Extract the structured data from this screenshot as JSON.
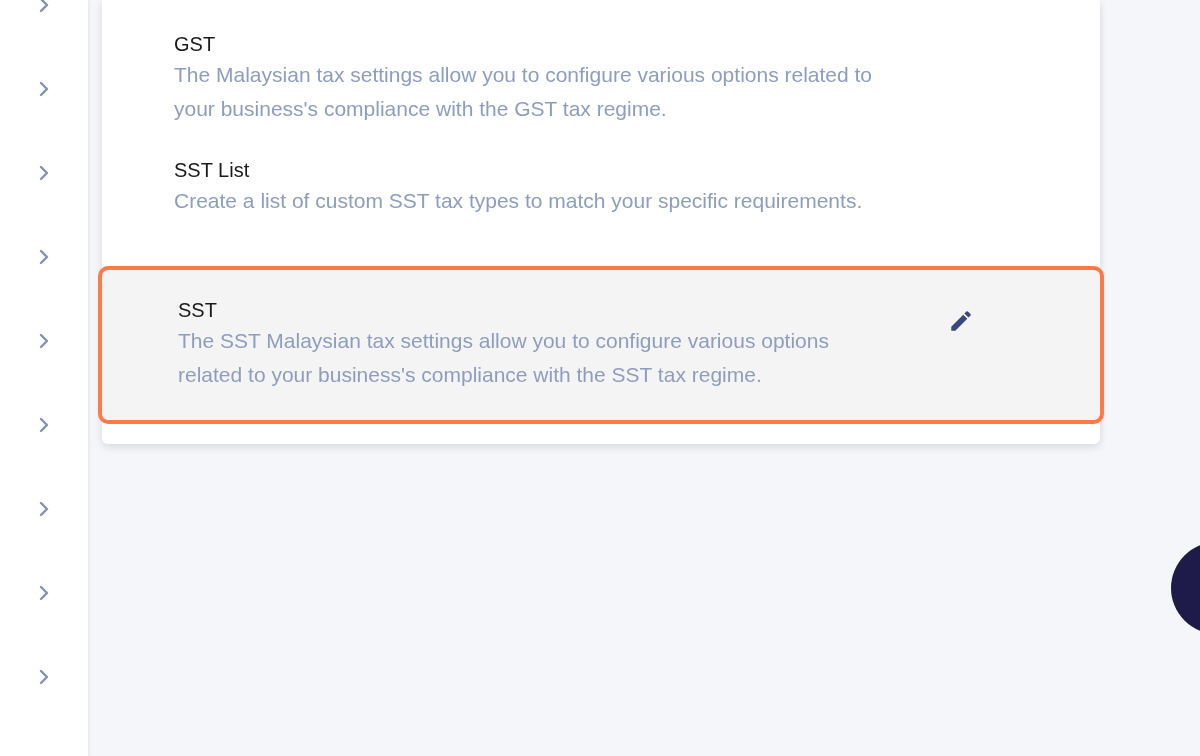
{
  "sidebar": {
    "items": [
      {
        "expanded": false
      },
      {
        "expanded": false
      },
      {
        "expanded": false
      },
      {
        "expanded": false
      },
      {
        "expanded": false
      },
      {
        "expanded": false
      },
      {
        "expanded": false
      },
      {
        "expanded": false
      },
      {
        "expanded": false
      }
    ]
  },
  "settings": [
    {
      "title": "GST",
      "description": "The Malaysian tax settings allow you to configure various options related to your business's compliance with the GST tax regime.",
      "selected": false
    },
    {
      "title": "SST List",
      "description": "Create a list of custom SST tax types to match your specific requirements.",
      "selected": false
    },
    {
      "title": "SST",
      "description": "The SST Malaysian tax settings allow you to configure various options related to your business's compliance with the SST tax regime.",
      "selected": true
    }
  ]
}
